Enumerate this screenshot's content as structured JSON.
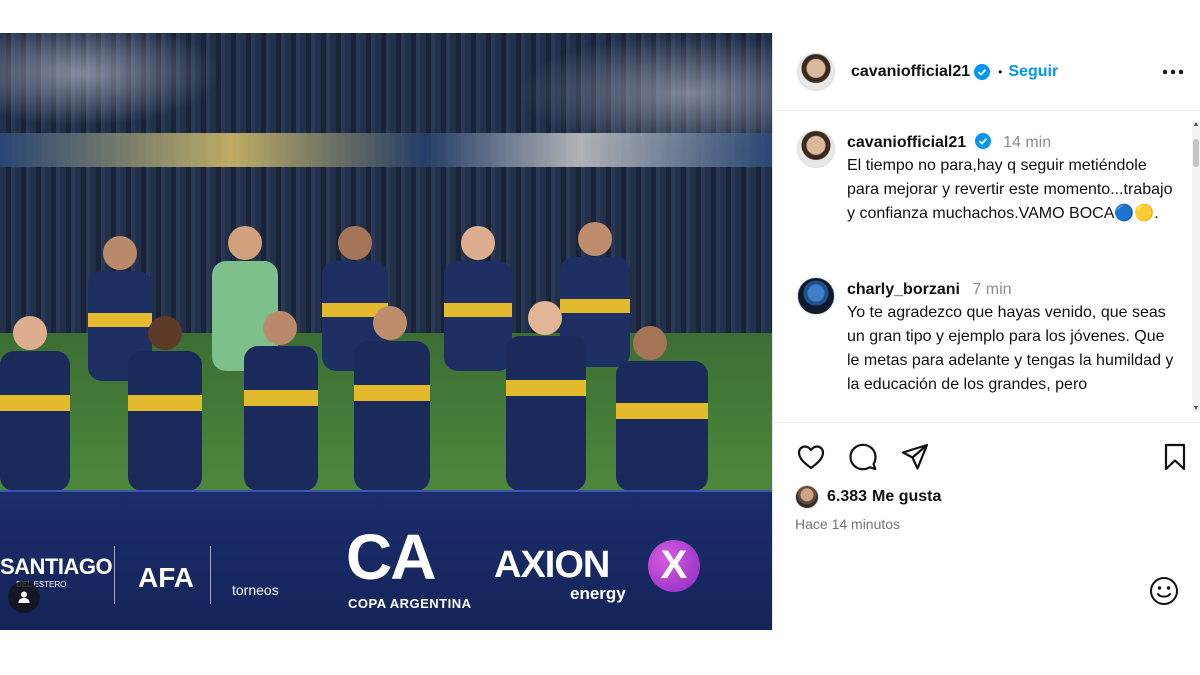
{
  "post": {
    "photo": {
      "alt": "",
      "board": {
        "santiago": "SANTIAGO",
        "santiago_sub": "DEL ESTERO",
        "afa": "AFA",
        "torneos": "torneos",
        "ca": "CA",
        "copa": "COPA ARGENTINA",
        "axion": "AXION",
        "energy": "energy",
        "x": "X"
      }
    },
    "author": {
      "username": "cavaniofficial21",
      "verified": true,
      "follow_label": "Seguir",
      "separator": "•"
    },
    "comments": [
      {
        "username": "cavaniofficial21",
        "verified": true,
        "time": "14 min",
        "text": "El tiempo no para,hay q seguir metiéndole para mejorar y revertir este momento...trabajo y confianza muchachos.VAMO BOCA🔵🟡."
      },
      {
        "username": "charly_borzani",
        "verified": false,
        "time": "7 min",
        "text": "Yo te agradezco que hayas venido, que seas un gran tipo y ejemplo para los jóvenes. Que le metas para adelante y tengas la humildad y la educación de los grandes, pero"
      }
    ],
    "likes": {
      "count": "6.383",
      "label": "Me gusta"
    },
    "time_ago": "Hace 14 minutos"
  },
  "colors": {
    "accent": "#0095f6",
    "verified": "#0095f6",
    "muted": "#8e8e8e"
  },
  "icons": {
    "more": "more-horizontal-icon",
    "like": "heart-icon",
    "comment": "comment-icon",
    "share": "send-icon",
    "save": "bookmark-icon",
    "emoji": "emoji-icon",
    "user_tag": "user-icon"
  }
}
